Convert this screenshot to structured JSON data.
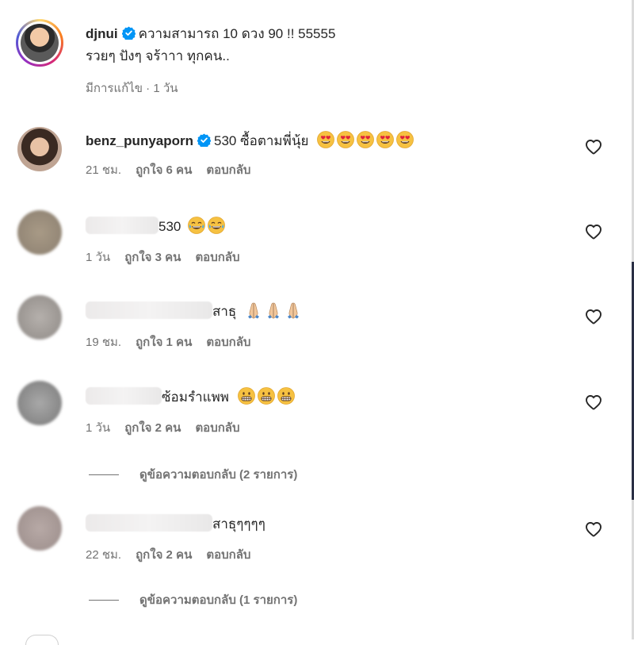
{
  "caption": {
    "username": "djnui",
    "line1": "ความสามารถ 10 ดวง 90 !! 55555",
    "line2": "รวยๆ ปังๆ จร้าาา ทุกคน..",
    "meta": "มีการแก้ไข · 1 วัน"
  },
  "comments": [
    {
      "username": "benz_punyaporn",
      "text": "530 ซื้อตามพี่นุ้ย",
      "emoji": "heart-eyes-emoji",
      "time": "21 ชม.",
      "likes": "ถูกใจ 6 คน",
      "reply": "ตอบกลับ"
    },
    {
      "text": "530",
      "emoji": "tears-of-joy-emoji",
      "time": "1 วัน",
      "likes": "ถูกใจ 3 คน",
      "reply": "ตอบกลับ"
    },
    {
      "text": "สาธุ",
      "emoji": "folded-hands-emoji",
      "time": "19 ชม.",
      "likes": "ถูกใจ 1 คน",
      "reply": "ตอบกลับ"
    },
    {
      "text": "ซ้อมรำแพพ",
      "emoji": "grimacing-emoji",
      "time": "1 วัน",
      "likes": "ถูกใจ 2 คน",
      "reply": "ตอบกลับ",
      "view_replies": "ดูข้อความตอบกลับ (2 รายการ)"
    },
    {
      "text": "สาธุๆๆๆๆ",
      "time": "22 ชม.",
      "likes": "ถูกใจ 2 คน",
      "reply": "ตอบกลับ",
      "view_replies": "ดูข้อความตอบกลับ (1 รายการ)"
    }
  ],
  "colors": {
    "verified": "#0095f6",
    "meta_text": "#737373",
    "text": "#262626"
  }
}
